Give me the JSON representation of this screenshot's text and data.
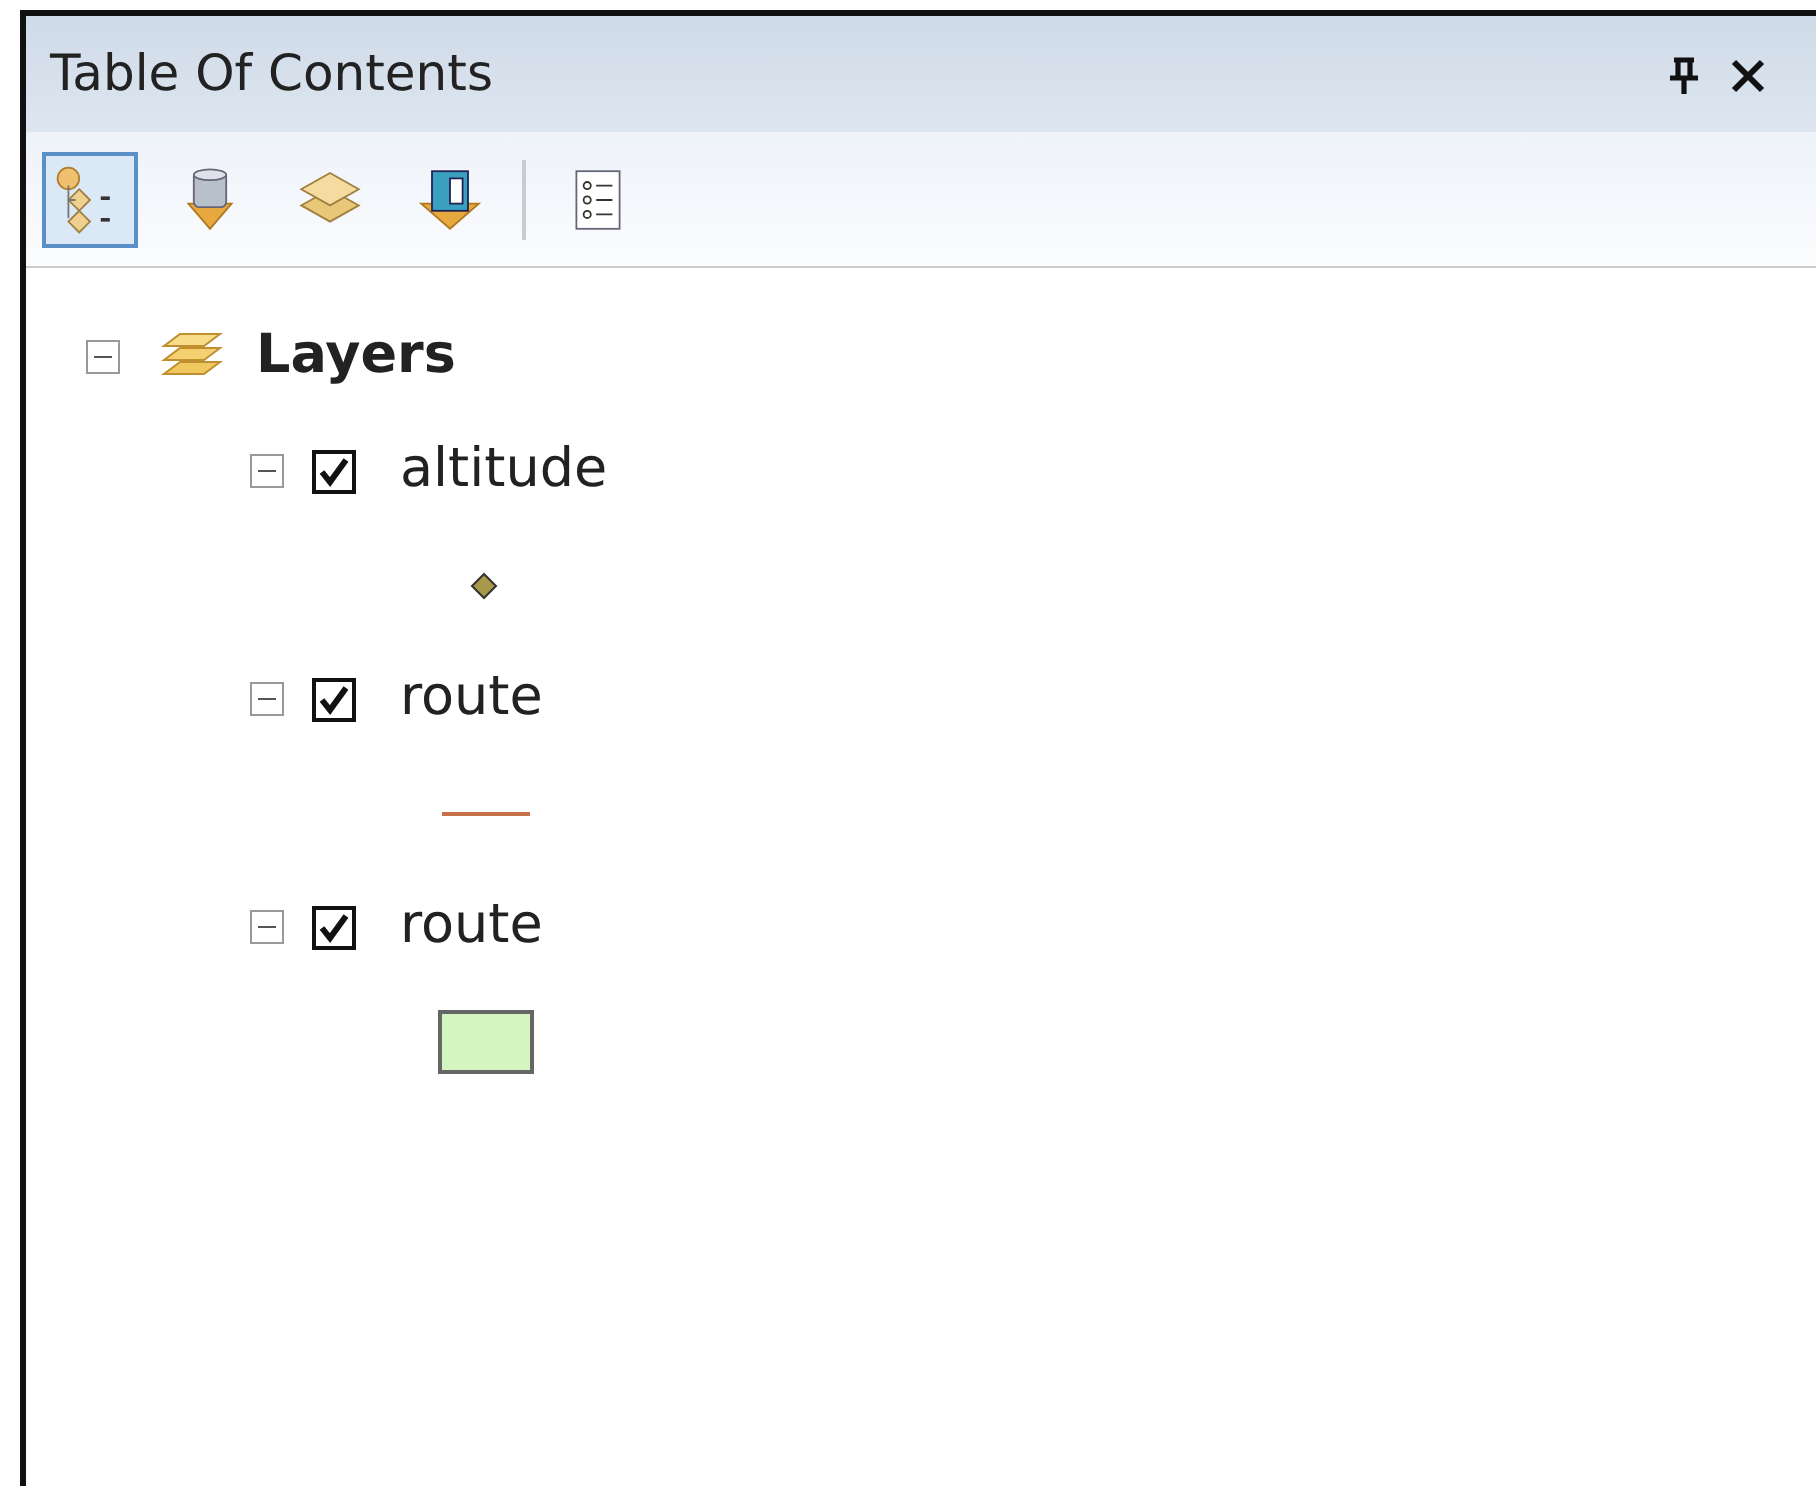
{
  "window": {
    "title": "Table Of Contents",
    "controls": [
      {
        "kind": "pin"
      },
      {
        "kind": "close"
      }
    ]
  },
  "toolbar": [
    {
      "kind": "list-by-drawing-order",
      "selected": true
    },
    {
      "kind": "list-by-source",
      "selected": false
    },
    {
      "kind": "list-by-visibility",
      "selected": false
    },
    {
      "kind": "list-by-selection",
      "selected": false
    },
    {
      "kind": "separator"
    },
    {
      "kind": "options",
      "selected": false
    }
  ],
  "tree": {
    "label": "Layers",
    "expanded": true,
    "children": [
      {
        "label": "altitude",
        "expanded": true,
        "checked": true,
        "symbol": {
          "kind": "point",
          "color": "#a8984a"
        }
      },
      {
        "label": "route",
        "expanded": true,
        "checked": true,
        "symbol": {
          "kind": "line",
          "color": "#c8704a"
        }
      },
      {
        "label": "route",
        "expanded": true,
        "checked": true,
        "symbol": {
          "kind": "polygon",
          "color": "#d4f4c0"
        }
      }
    ]
  }
}
